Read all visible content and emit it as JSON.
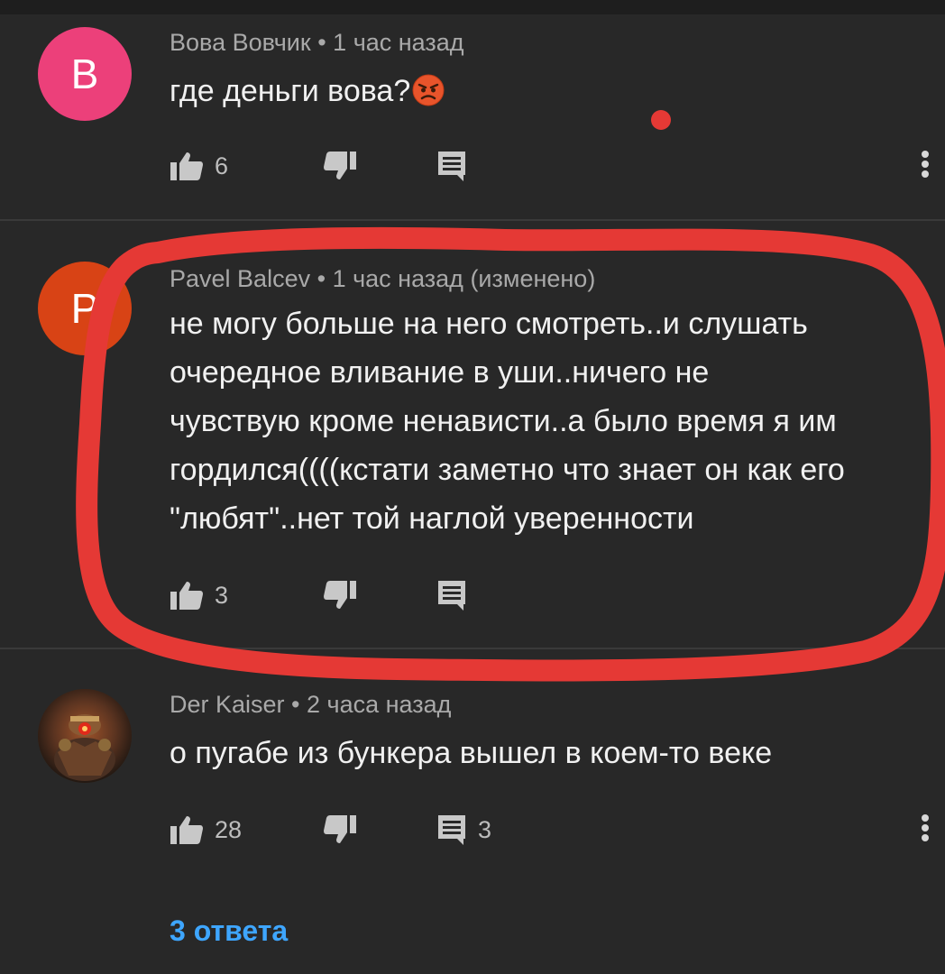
{
  "comments": [
    {
      "avatar_letter": "B",
      "avatar_color": "#ec407a",
      "author": "Вова Вовчик",
      "time": "1 час назад",
      "text": "где деньги вова?",
      "emoji": "angry-face",
      "likes": "6",
      "replies_count": ""
    },
    {
      "avatar_letter": "P",
      "avatar_color": "#d84315",
      "author": "Pavel Balcev",
      "time": "1 час назад (изменено)",
      "text_lines": [
        "не могу больше на него смотреть..и слушать",
        "очередное вливание в уши..ничего не",
        "чувствую кроме ненависти..а было время я им",
        "гордился((((кстати заметно что знает он как его",
        "\"любят\"..нет той наглой уверенности"
      ],
      "likes": "3",
      "replies_count": ""
    },
    {
      "avatar_letter": "",
      "author": "Der Kaiser",
      "time": "2 часа назад",
      "text": "о пугабе из бункера вышел в коем-то веке",
      "likes": "28",
      "replies_count": "3"
    }
  ],
  "separator": " • ",
  "view_replies": "3 ответа",
  "colors": {
    "background": "#282828",
    "link": "#3ea6ff",
    "annotation": "#e53935"
  }
}
